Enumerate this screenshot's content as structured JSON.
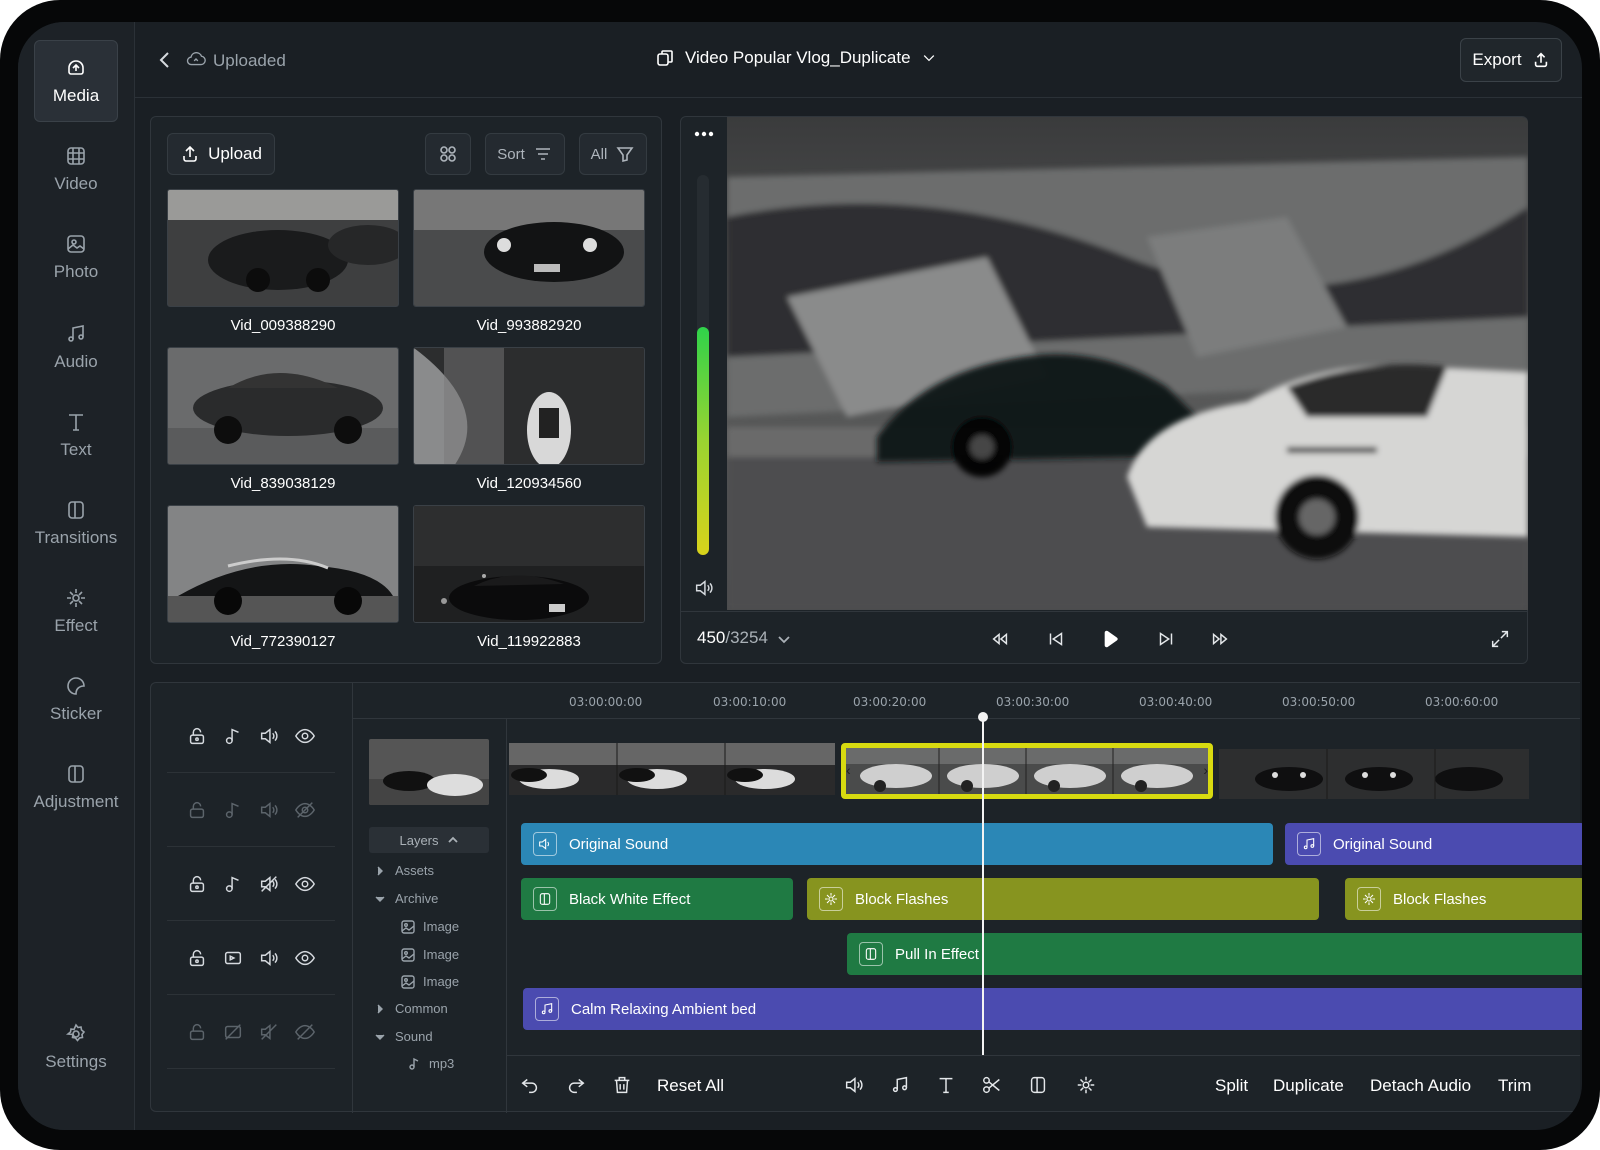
{
  "nav": {
    "items": [
      {
        "label": "Media",
        "icon": "media-icon"
      },
      {
        "label": "Video",
        "icon": "video-icon"
      },
      {
        "label": "Photo",
        "icon": "photo-icon"
      },
      {
        "label": "Audio",
        "icon": "audio-icon"
      },
      {
        "label": "Text",
        "icon": "text-icon"
      },
      {
        "label": "Transitions",
        "icon": "transitions-icon"
      },
      {
        "label": "Effect",
        "icon": "effect-icon"
      },
      {
        "label": "Sticker",
        "icon": "sticker-icon"
      },
      {
        "label": "Adjustment",
        "icon": "adjustment-icon"
      }
    ],
    "settings_label": "Settings"
  },
  "header": {
    "breadcrumb": "Uploaded",
    "project_title": "Video Popular Vlog_Duplicate",
    "export_label": "Export"
  },
  "media": {
    "upload_label": "Upload",
    "sort_label": "Sort",
    "filter_label": "All",
    "clips": [
      {
        "name": "Vid_009388290"
      },
      {
        "name": "Vid_993882920"
      },
      {
        "name": "Vid_839038129"
      },
      {
        "name": "Vid_120934560"
      },
      {
        "name": "Vid_772390127"
      },
      {
        "name": "Vid_119922883"
      }
    ]
  },
  "preview": {
    "current_frame": "450",
    "total_frames": "/3254",
    "volume_level": 0.6
  },
  "timeline": {
    "ruler": [
      "03:00:00:00",
      "03:00:10:00",
      "03:00:20:00",
      "03:00:30:00",
      "03:00:40:00",
      "03:00:50:00",
      "03:00:60:00"
    ],
    "layers_label": "Layers",
    "tree": [
      {
        "label": "Assets",
        "kind": "folder",
        "open": false
      },
      {
        "label": "Archive",
        "kind": "folder",
        "open": true
      },
      {
        "label": "Image",
        "kind": "image"
      },
      {
        "label": "Image",
        "kind": "image"
      },
      {
        "label": "Image",
        "kind": "image"
      },
      {
        "label": "Common",
        "kind": "folder",
        "open": false
      },
      {
        "label": "Sound",
        "kind": "folder",
        "open": true
      },
      {
        "label": "mp3",
        "kind": "audio"
      }
    ],
    "bars": {
      "original_sound_1": "Original Sound",
      "original_sound_2": "Original Sound",
      "black_white": "Black White Effect",
      "block_flashes_1": "Block Flashes",
      "block_flashes_2": "Block Flashes",
      "pull_in": "Pull In Effect",
      "ambient": "Calm Relaxing Ambient bed"
    },
    "colors": {
      "sound": "#2b87b6",
      "sound_alt": "#4b4bb0",
      "green": "#1f7a43",
      "olive": "#87941f",
      "selection": "#d8da10",
      "ambient": "#4b4bb0"
    }
  },
  "toolbar": {
    "reset_label": "Reset All",
    "split_label": "Split",
    "duplicate_label": "Duplicate",
    "detach_label": "Detach Audio",
    "trim_label": "Trim"
  }
}
